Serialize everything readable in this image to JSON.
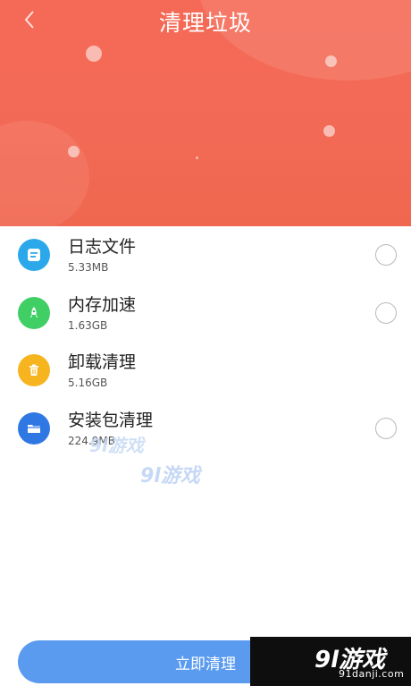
{
  "header": {
    "title": "清理垃圾",
    "background_color": "#f26a55"
  },
  "icons": {
    "back": "chevron-left-icon",
    "log": "document-icon",
    "memory": "rocket-icon",
    "uninstall": "trash-icon",
    "apk": "folder-icon"
  },
  "items": [
    {
      "name": "日志文件",
      "size": "5.33MB",
      "icon_color": "#2aa8ea",
      "checked": false
    },
    {
      "name": "内存加速",
      "size": "1.63GB",
      "icon_color": "#3fcf64",
      "checked": false
    },
    {
      "name": "卸载清理",
      "size": "5.16GB",
      "icon_color": "#f6b41f",
      "checked": false
    },
    {
      "name": "安装包清理",
      "size": "224.9MB",
      "icon_color": "#2f78e4",
      "checked": false
    }
  ],
  "watermark": {
    "text1": "9l游戏",
    "text2": "9l游戏",
    "logo_big": "9l游戏",
    "logo_url": "91danji.com"
  },
  "action": {
    "clean_label": "立即清理",
    "button_color": "#5a9bf0"
  }
}
